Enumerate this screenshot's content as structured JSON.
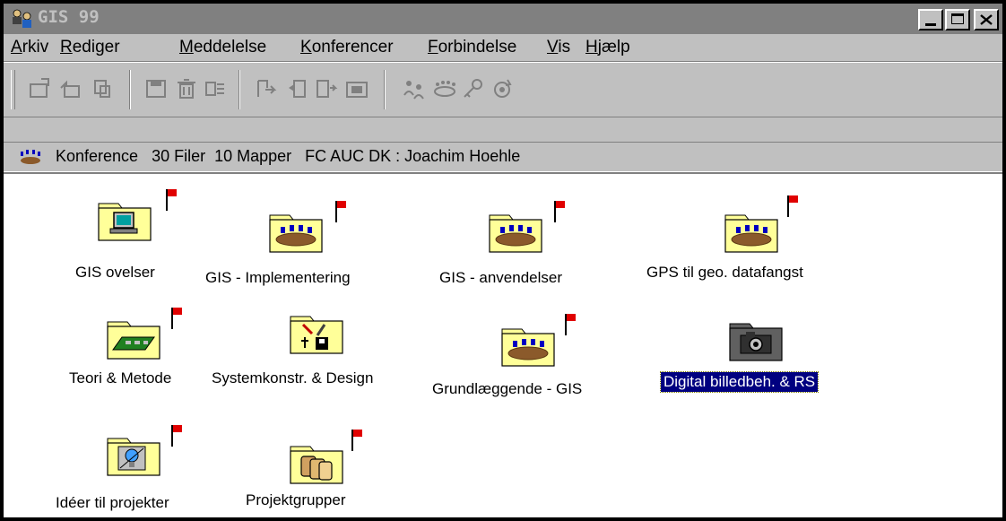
{
  "window": {
    "title": "GIS 99",
    "icon": "people-app-icon"
  },
  "window_controls": [
    "minimize",
    "maximize",
    "close"
  ],
  "menu": [
    {
      "key": "A",
      "rest": "rkiv"
    },
    {
      "key": "R",
      "rest": "ediger"
    },
    {
      "key": "M",
      "rest": "eddelelse"
    },
    {
      "key": "K",
      "rest": "onferencer"
    },
    {
      "key": "F",
      "rest": "orbindelse"
    },
    {
      "key": "V",
      "rest": "is"
    },
    {
      "key": "H",
      "rest": "jælp"
    }
  ],
  "toolbar": {
    "icons": [
      "new-message-icon",
      "reply-icon",
      "copy-icon",
      "save-icon",
      "delete-icon",
      "forward-icon",
      "next-icon",
      "previous-icon",
      "read-icon",
      "open-icon",
      "users-icon",
      "conference-icon",
      "key-icon",
      "sync-icon"
    ]
  },
  "status": {
    "text": "Konference   30 Filer  10 Mapper   FC AUC DK : Joachim Hoehle",
    "icon": "conference-icon"
  },
  "folders": [
    {
      "label": "GIS ovelser",
      "icon": "computer-icon",
      "flag": true
    },
    {
      "label": "GIS - Implementering",
      "icon": "meeting-table-icon",
      "flag": true
    },
    {
      "label": "GIS - anvendelser",
      "icon": "meeting-table-icon",
      "flag": true
    },
    {
      "label": "GPS til geo. datafangst",
      "icon": "meeting-table-icon",
      "flag": true
    },
    {
      "label": "Teori & Metode",
      "icon": "circuit-board-icon",
      "flag": true
    },
    {
      "label": "Systemkonstr. & Design",
      "icon": "tools-disk-icon",
      "flag": false
    },
    {
      "label": "Grundlæggende - GIS",
      "icon": "meeting-table-icon",
      "flag": true
    },
    {
      "label": "Digital billedbeh. & RS",
      "icon": "camera-icon",
      "flag": false,
      "selected": true
    },
    {
      "label": "Idéer til projekter",
      "icon": "lightbulb-icon",
      "flag": true
    },
    {
      "label": "Projektgrupper",
      "icon": "people-group-icon",
      "flag": true
    }
  ],
  "colors": {
    "titlebar": "#808080",
    "face": "#c0c0c0",
    "folder": "#ffff99",
    "flag": "#e00000",
    "selection": "#000080"
  }
}
